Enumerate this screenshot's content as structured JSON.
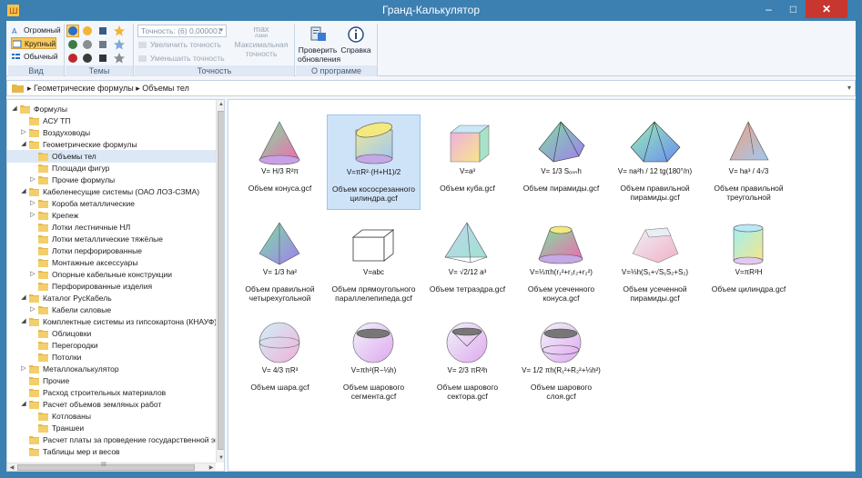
{
  "window": {
    "title": "Гранд-Калькулятор",
    "controls": {
      "minimize": "–",
      "maximize": "□",
      "close": "✕"
    }
  },
  "ribbon": {
    "view_group": {
      "label": "Вид",
      "items": [
        {
          "label": "Огромный",
          "selected": false
        },
        {
          "label": "Крупный",
          "selected": true
        },
        {
          "label": "Обычный",
          "selected": false
        }
      ]
    },
    "themes_group": {
      "label": "Темы"
    },
    "precision_group": {
      "label": "Точность",
      "combo_value": "Точность: (6) 0,000001",
      "increase": "Увеличить точность",
      "decrease": "Уменьшить точность",
      "max_big": "max",
      "max_small": "лами",
      "max_label_1": "Максимальная",
      "max_label_2": "точность"
    },
    "about_group": {
      "label": "О программе",
      "update_label_1": "Проверить",
      "update_label_2": "обновления ▾",
      "help_label": "Справка"
    }
  },
  "breadcrumb": {
    "path": "▸ Геометрические формулы ▸ Объемы тел",
    "dropdown": "▾"
  },
  "tree": {
    "items": [
      {
        "label": "Формулы",
        "level": 0,
        "exp": "◢"
      },
      {
        "label": "АСУ ТП",
        "level": 1,
        "exp": ""
      },
      {
        "label": "Воздуховоды",
        "level": 1,
        "exp": "▷"
      },
      {
        "label": "Геометрические формулы",
        "level": 1,
        "exp": "◢"
      },
      {
        "label": "Объемы тел",
        "level": 2,
        "exp": "",
        "selected": true
      },
      {
        "label": "Площади фигур",
        "level": 2,
        "exp": ""
      },
      {
        "label": "Прочие формулы",
        "level": 2,
        "exp": "▷"
      },
      {
        "label": "Кабеленесущие системы (ОАО ЛОЗ-СЗМА)",
        "level": 1,
        "exp": "◢"
      },
      {
        "label": "Короба металлические",
        "level": 2,
        "exp": "▷"
      },
      {
        "label": "Крепеж",
        "level": 2,
        "exp": "▷"
      },
      {
        "label": "Лотки лестничные НЛ",
        "level": 2,
        "exp": ""
      },
      {
        "label": "Лотки металлические тяжёлые",
        "level": 2,
        "exp": ""
      },
      {
        "label": "Лотки перфорированные",
        "level": 2,
        "exp": ""
      },
      {
        "label": "Монтажные аксессуары",
        "level": 2,
        "exp": ""
      },
      {
        "label": "Опорные кабельные конструкции",
        "level": 2,
        "exp": "▷"
      },
      {
        "label": "Перфорированные изделия",
        "level": 2,
        "exp": ""
      },
      {
        "label": "Каталог РусКабель",
        "level": 1,
        "exp": "◢"
      },
      {
        "label": "Кабели силовые",
        "level": 2,
        "exp": "▷"
      },
      {
        "label": "Комплектные системы из гипсокартона (КНАУФ)",
        "level": 1,
        "exp": "◢"
      },
      {
        "label": "Облицовки",
        "level": 2,
        "exp": ""
      },
      {
        "label": "Перегородки",
        "level": 2,
        "exp": ""
      },
      {
        "label": "Потолки",
        "level": 2,
        "exp": ""
      },
      {
        "label": "Металлокалькулятор",
        "level": 1,
        "exp": "▷"
      },
      {
        "label": "Прочие",
        "level": 1,
        "exp": ""
      },
      {
        "label": "Расход строительных материалов",
        "level": 1,
        "exp": ""
      },
      {
        "label": "Расчет объемов земляных работ",
        "level": 1,
        "exp": "◢"
      },
      {
        "label": "Котлованы",
        "level": 2,
        "exp": ""
      },
      {
        "label": "Траншеи",
        "level": 2,
        "exp": ""
      },
      {
        "label": "Расчет платы за проведение государственной экспертизы",
        "level": 1,
        "exp": ""
      },
      {
        "label": "Таблицы мер и весов",
        "level": 1,
        "exp": ""
      }
    ],
    "scroll_mid": "III"
  },
  "files": [
    {
      "name": "Объем конуса.gcf",
      "formula": "V= H/3 R²π",
      "shape": "cone",
      "selected": false
    },
    {
      "name": "Объем кососрезанного цилиндра.gcf",
      "formula": "V=πR²·(H+H1)/2",
      "shape": "slanted-cylinder",
      "selected": true
    },
    {
      "name": "Объем куба.gcf",
      "formula": "V=a³",
      "shape": "cube",
      "selected": false
    },
    {
      "name": "Объем пирамиды.gcf",
      "formula": "V= 1/3 Sₒₛₙh",
      "shape": "pyramid",
      "selected": false
    },
    {
      "name": "Объем правильной пирамиды.gcf",
      "formula": "V= na²h / 12 tg(180°/n)",
      "shape": "regular-pyramid",
      "selected": false
    },
    {
      "name": "Объем правильной треугольной",
      "formula": "V= ha³ / 4√3",
      "shape": "triangular-pyramid",
      "selected": false
    },
    {
      "name": "Объем правильной четырехугольной",
      "formula": "V= 1/3 ha²",
      "shape": "square-pyramid",
      "selected": false
    },
    {
      "name": "Объем прямоугольного параллелепипеда.gcf",
      "formula": "V=abc",
      "shape": "box",
      "selected": false
    },
    {
      "name": "Объем тетраэдра.gcf",
      "formula": "V= √2/12 a³",
      "shape": "tetrahedron",
      "selected": false
    },
    {
      "name": "Объем усеченного конуса.gcf",
      "formula": "V=⅓πh(r₁²+r₁r₂+r₂²)",
      "shape": "frustum-cone",
      "selected": false
    },
    {
      "name": "Объем усеченной пирамиды.gcf",
      "formula": "V=⅓h(S₁+√S₁S₂+S₂)",
      "shape": "frustum-pyramid",
      "selected": false
    },
    {
      "name": "Объем цилиндра.gcf",
      "formula": "V=πR²H",
      "shape": "cylinder",
      "selected": false
    },
    {
      "name": "Объем шара.gcf",
      "formula": "V= 4/3 πR³",
      "shape": "sphere",
      "selected": false
    },
    {
      "name": "Объем шарового сегмента.gcf",
      "formula": "V=πh²(R−⅓h)",
      "shape": "sphere-segment",
      "selected": false
    },
    {
      "name": "Объем шарового сектора.gcf",
      "formula": "V= 2/3 πR²h",
      "shape": "sphere-sector",
      "selected": false
    },
    {
      "name": "Объем шарового слоя.gcf",
      "formula": "V= 1/2 πh(R₁²+R₂²+⅓h²)",
      "shape": "sphere-layer",
      "selected": false
    }
  ]
}
